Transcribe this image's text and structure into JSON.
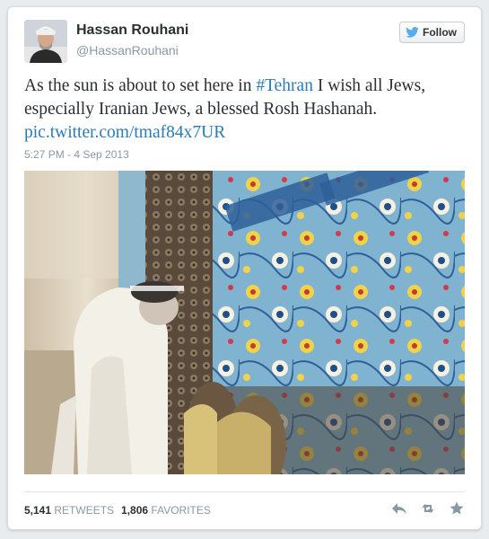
{
  "user": {
    "name": "Hassan Rouhani",
    "handle": "@HassanRouhani"
  },
  "follow_button": {
    "label": "Follow"
  },
  "tweet": {
    "text_before": "As the sun is about to set here in ",
    "hashtag": "#Tehran",
    "text_after": " I wish all Jews, especially Iranian Jews, a blessed Rosh Hashanah.",
    "link": "pic.twitter.com/tmaf84x7UR",
    "timestamp": "5:27 PM - 4 Sep 2013"
  },
  "stats": {
    "retweets_count": "5,141",
    "retweets_label": "RETWEETS",
    "favorites_count": "1,806",
    "favorites_label": "FAVORITES"
  },
  "icons": {
    "reply": "reply-icon",
    "retweet": "retweet-icon",
    "favorite": "star-icon",
    "bird": "twitter-bird-icon"
  },
  "colors": {
    "link": "#2b7bb9",
    "muted": "#8899a6",
    "text": "#292f33"
  }
}
